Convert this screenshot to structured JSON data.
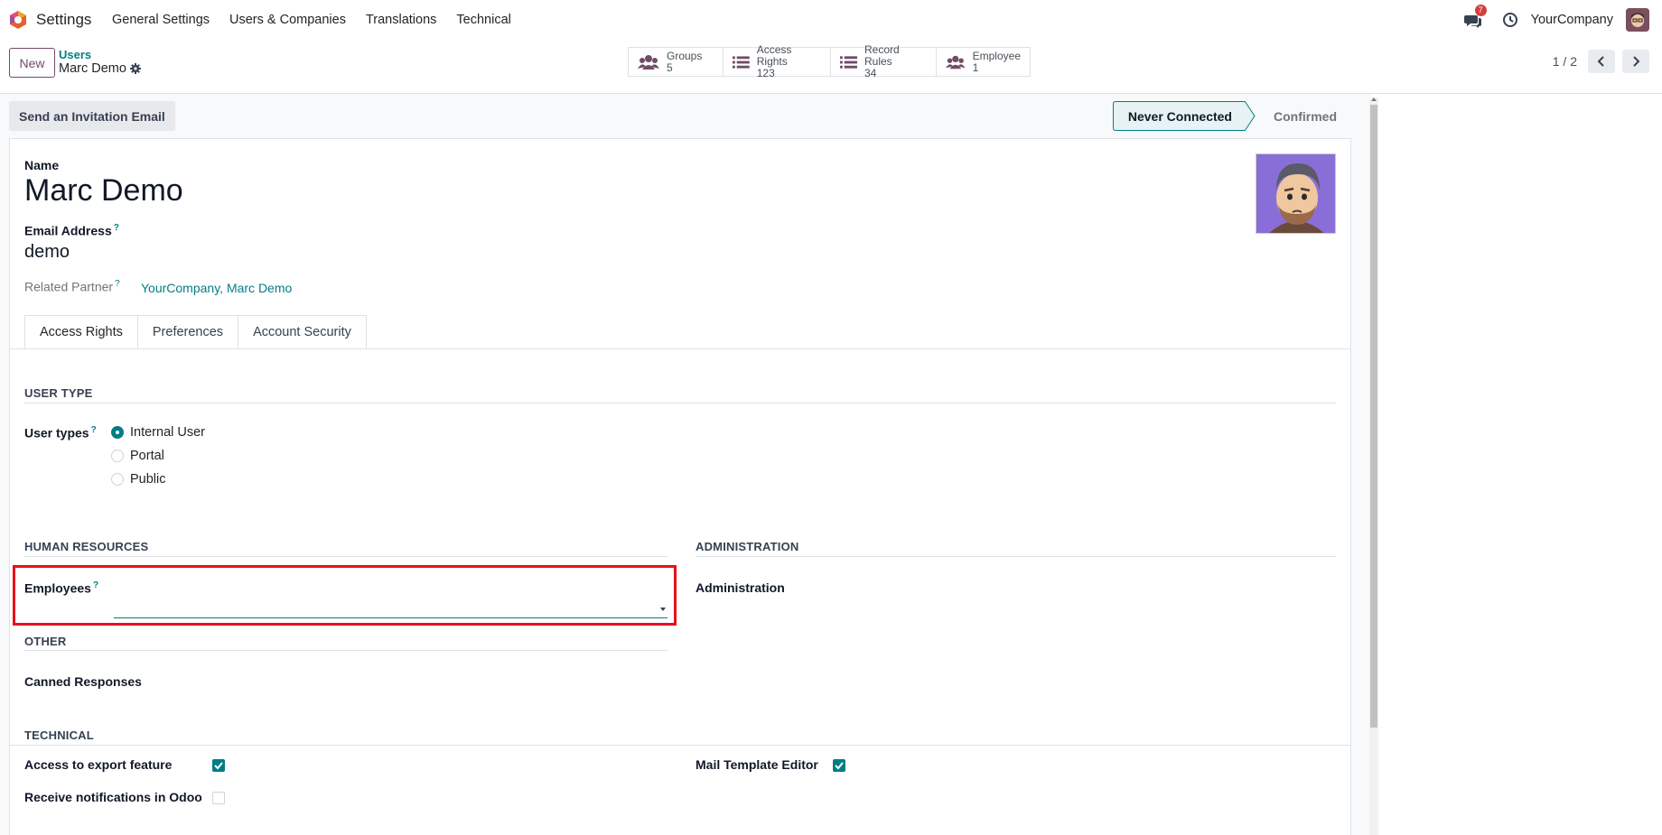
{
  "navbar": {
    "app_name": "Settings",
    "menu": [
      "General Settings",
      "Users & Companies",
      "Translations",
      "Technical"
    ],
    "chat_badge": "7",
    "company": "YourCompany"
  },
  "control": {
    "new_label": "New",
    "breadcrumb_parent": "Users",
    "breadcrumb_current": "Marc Demo",
    "smart_buttons": [
      {
        "label": "Groups",
        "count": "5",
        "icon": "users-icon"
      },
      {
        "label": "Access Rights",
        "count": "123",
        "icon": "list-icon"
      },
      {
        "label": "Record Rules",
        "count": "34",
        "icon": "list-icon"
      },
      {
        "label": "Employee",
        "count": "1",
        "icon": "users-icon"
      }
    ],
    "pager": "1 / 2"
  },
  "statusbar": {
    "invite_label": "Send an Invitation Email",
    "stage_active": "Never Connected",
    "stage_next": "Confirmed"
  },
  "form": {
    "name_label": "Name",
    "name_value": "Marc Demo",
    "email_label": "Email Address",
    "email_value": "demo",
    "partner_label": "Related Partner",
    "partner_value": "YourCompany, Marc Demo",
    "help_mark": "?"
  },
  "tabs": [
    "Access Rights",
    "Preferences",
    "Account Security"
  ],
  "access": {
    "user_type_title": "USER TYPE",
    "user_types_label": "User types",
    "user_type_options": [
      "Internal User",
      "Portal",
      "Public"
    ],
    "selected_user_type": "Internal User",
    "hr_title": "HUMAN RESOURCES",
    "employees_label": "Employees",
    "employees_value": "",
    "admin_title": "ADMINISTRATION",
    "admin_label": "Administration",
    "other_title": "OTHER",
    "canned_label": "Canned Responses",
    "technical_title": "TECHNICAL",
    "export_label": "Access to export feature",
    "export_checked": true,
    "notif_label": "Receive notifications in Odoo",
    "notif_checked": false,
    "mail_template_label": "Mail Template Editor",
    "mail_template_checked": true
  },
  "colors": {
    "brand": "#714b67",
    "accent": "#017e84",
    "highlight": "#e5121c"
  }
}
